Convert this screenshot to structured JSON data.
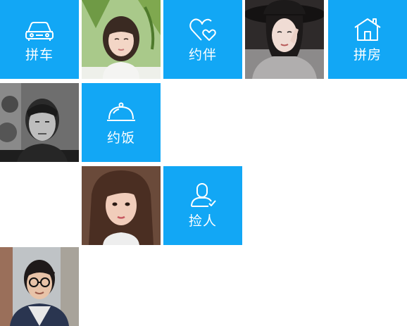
{
  "colors": {
    "tile_blue": "#12a7f5",
    "background": "#ffffff"
  },
  "categories": [
    {
      "label": "拼车",
      "icon": "car-icon"
    },
    {
      "label": "约伴",
      "icon": "heart-icon"
    },
    {
      "label": "拼房",
      "icon": "house-icon"
    },
    {
      "label": "约饭",
      "icon": "dish-cloche-icon"
    },
    {
      "label": "捡人",
      "icon": "person-check-icon"
    }
  ],
  "profiles": [
    {
      "avatar": "user-avatar-girl-short-hair"
    },
    {
      "avatar": "user-avatar-girl-black-hat"
    },
    {
      "avatar": "user-avatar-boy-grayscale"
    },
    {
      "avatar": "user-avatar-girl-long-hair"
    },
    {
      "avatar": "user-avatar-boy-glasses"
    }
  ]
}
